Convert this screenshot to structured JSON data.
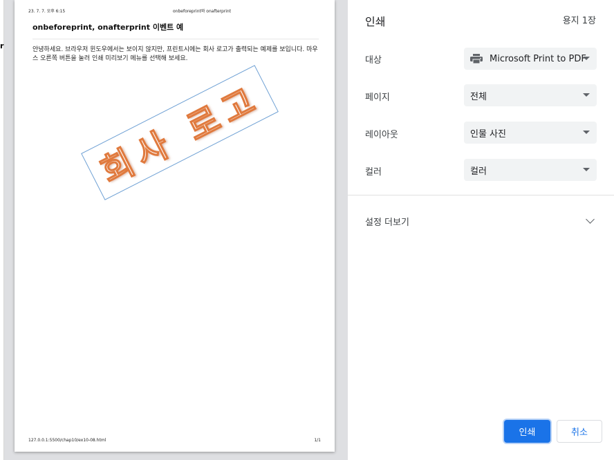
{
  "underlying_page": {
    "fragment": "r"
  },
  "preview": {
    "header_date": "23. 7. 7. 오후 6:15",
    "header_title": "onbeforeprint와 onafterprint",
    "heading": "onbeforeprint, onafterprint 이벤트 예",
    "body_text": "안녕하세요. 브라우저 윈도우에서는 보이지 않지만, 프린트시에는 회사 로고가 출력되는 예제를 보입니다. 마우스 오른쪽 버튼을 눌러 인쇄 미리보기 메뉴를 선택해 보세요.",
    "logo_text": "회사 로고",
    "footer_url": "127.0.0.1:5500/chap10/ex10-08.html",
    "footer_page": "1/1"
  },
  "panel": {
    "title": "인쇄",
    "sheet_count": "용지 1장",
    "destination": {
      "label": "대상",
      "value": "Microsoft Print to PDF",
      "icon": "printer-icon"
    },
    "pages": {
      "label": "페이지",
      "value": "전체"
    },
    "layout": {
      "label": "레이아웃",
      "value": "인물 사진"
    },
    "color": {
      "label": "컬러",
      "value": "컬러"
    },
    "more_settings": "설정 더보기",
    "print_button": "인쇄",
    "cancel_button": "취소",
    "accent_color": "#1a73e8"
  }
}
